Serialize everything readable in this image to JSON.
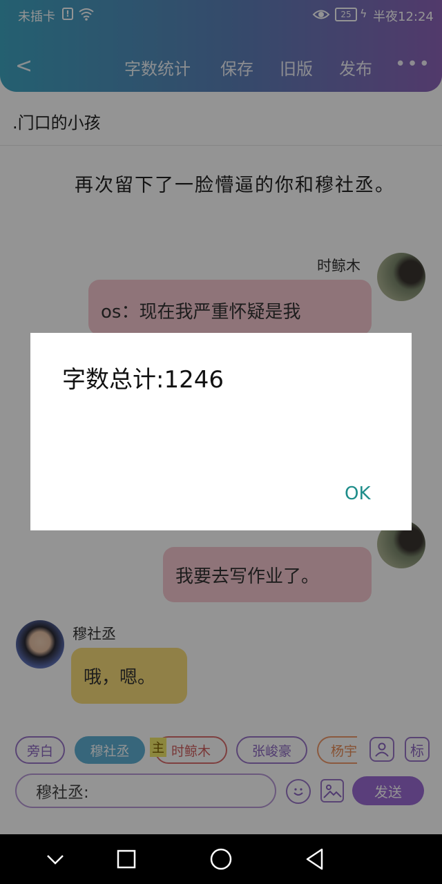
{
  "status_bar": {
    "carrier": "未插卡",
    "time": "半夜12:24",
    "battery": "25"
  },
  "toolbar": {
    "back": "<",
    "word_count": "字数统计",
    "save": "保存",
    "old_version": "旧版",
    "publish": "发布",
    "more": "•••"
  },
  "chapter_title": ".门口的小孩",
  "narration": "再次留下了一脸懵逼的你和穆社丞。",
  "messages": [
    {
      "speaker": "时鲸木",
      "text": "os：现在我严重怀疑是我"
    },
    {
      "speaker": "时鲸木",
      "text": "我要去写作业了。"
    },
    {
      "speaker": "穆社丞",
      "text": "哦，嗯。"
    }
  ],
  "dialog": {
    "message": "字数总计:1246",
    "ok": "OK"
  },
  "characters": [
    {
      "name": "旁白"
    },
    {
      "name": "穆社丞"
    },
    {
      "name": "时鲸木",
      "tag": "主"
    },
    {
      "name": "张峻豪"
    },
    {
      "name": "杨宇"
    }
  ],
  "input": {
    "placeholder": "穆社丞:",
    "send": "发送",
    "tag_icon": "标"
  },
  "colors": {
    "header_start": "#3fa5c2",
    "header_end": "#8d64b8",
    "accent": "#9b6bd4",
    "dialog_ok": "#1e8d8a"
  }
}
